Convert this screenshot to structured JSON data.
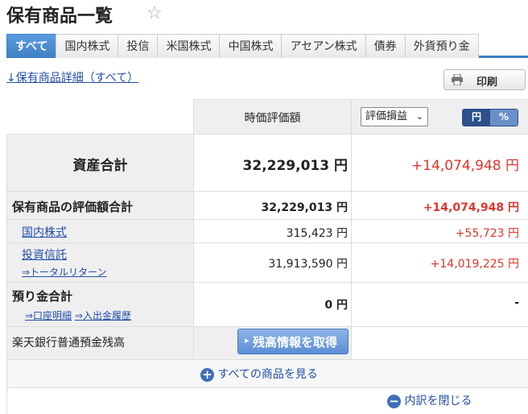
{
  "page": {
    "title": "保有商品一覧"
  },
  "tabs": [
    "すべて",
    "国内株式",
    "投信",
    "米国株式",
    "中国株式",
    "アセアン株式",
    "債券",
    "外貨預り金"
  ],
  "links": {
    "detail": "↓保有商品詳細（すべて）"
  },
  "print": {
    "label": "印刷"
  },
  "header": {
    "market_value": "時価評価額",
    "select_value": "評価損益",
    "toggle_yen": "円",
    "toggle_pct": "%"
  },
  "total": {
    "label": "資産合計",
    "value": "32,229,013 円",
    "profit": "+14,074,948 円"
  },
  "holdings": {
    "label": "保有商品の評価額合計",
    "value": "32,229,013 円",
    "profit": "+14,074,948 円",
    "rows": [
      {
        "label": "国内株式",
        "value": "315,423 円",
        "profit": "+55,723 円"
      },
      {
        "label": "投資信託",
        "sublink": "⇒トータルリターン",
        "value": "31,913,590 円",
        "profit": "+14,019,225 円"
      }
    ]
  },
  "deposit": {
    "label": "預り金合計",
    "link1": "⇒口座明細",
    "link2": "⇒入出金履歴",
    "value": "0 円",
    "profit": "-"
  },
  "bank": {
    "label": "楽天銀行普通預金残高",
    "button": "残高情報を取得"
  },
  "footer": {
    "show_all": "すべての商品を見る",
    "close": "内訳を閉じる"
  },
  "colors": {
    "accent": "#3f7fc4",
    "profit": "#e0352f"
  }
}
